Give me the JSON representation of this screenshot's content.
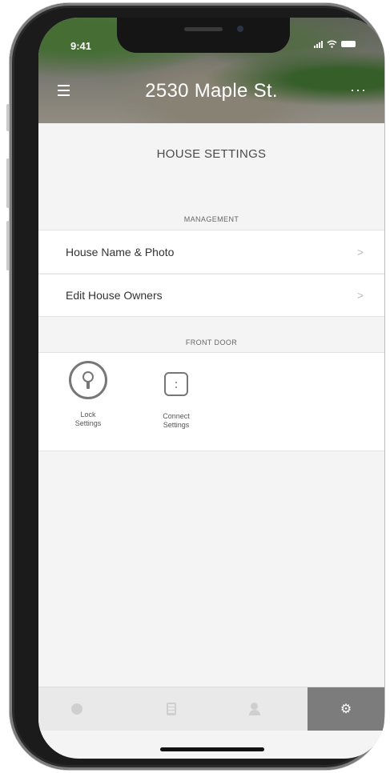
{
  "status": {
    "time": "9:41"
  },
  "header": {
    "address": "2530 Maple St.",
    "more": "···"
  },
  "page": {
    "title": "HOUSE SETTINGS"
  },
  "management": {
    "header": "MANAGEMENT",
    "items": [
      {
        "label": "House Name & Photo",
        "chevron": ">"
      },
      {
        "label": "Edit House Owners",
        "chevron": ">"
      }
    ]
  },
  "front_door": {
    "header": "FRONT DOOR",
    "tiles": [
      {
        "label_line1": "Lock",
        "label_line2": "Settings",
        "icon": "lock-icon"
      },
      {
        "label_line1": "Connect",
        "label_line2": "Settings",
        "icon": "connect-icon"
      }
    ]
  },
  "tabbar": {
    "tabs": [
      {
        "icon": "activity-icon",
        "active": false
      },
      {
        "icon": "list-icon",
        "active": false
      },
      {
        "icon": "guests-icon",
        "active": false
      },
      {
        "icon": "settings-gear-icon",
        "active": true,
        "glyph": "⚙"
      }
    ]
  }
}
